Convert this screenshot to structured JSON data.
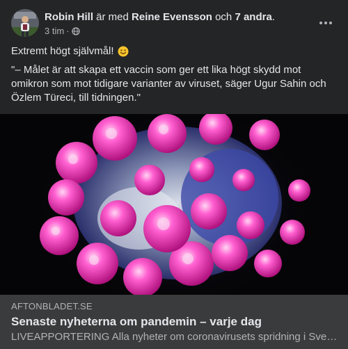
{
  "post": {
    "author": "Robin Hill",
    "with_text": " är med ",
    "tagged_person": "Reine Evensson",
    "and_text": " och ",
    "others": "7 andra",
    "period": ".",
    "timestamp": "3 tim",
    "separator": "·",
    "audience_icon": "globe-icon",
    "more_icon": "more-options-icon",
    "text_line1": "Extremt högt självmål!",
    "emoji": "smiley-emoji",
    "quote": "\"– Målet är att skapa ett vaccin som ger ett lika högt skydd mot omikron som mot tidigare varianter av viruset, säger Ugur Sahin och Özlem Türeci, till tidningen.\""
  },
  "link_preview": {
    "domain": "AFTONBLADET.SE",
    "headline": "Senaste nyheterna om pandemin – varje dag",
    "description": "LIVEAPPORTERING Alla nyheter om coronavirusets spridning i Sverige och i världen."
  },
  "colors": {
    "background": "#242526",
    "card": "#3a3b3c",
    "text_primary": "#e4e6eb",
    "text_secondary": "#b0b3b8",
    "virus_pink": "#ff4fc8"
  }
}
